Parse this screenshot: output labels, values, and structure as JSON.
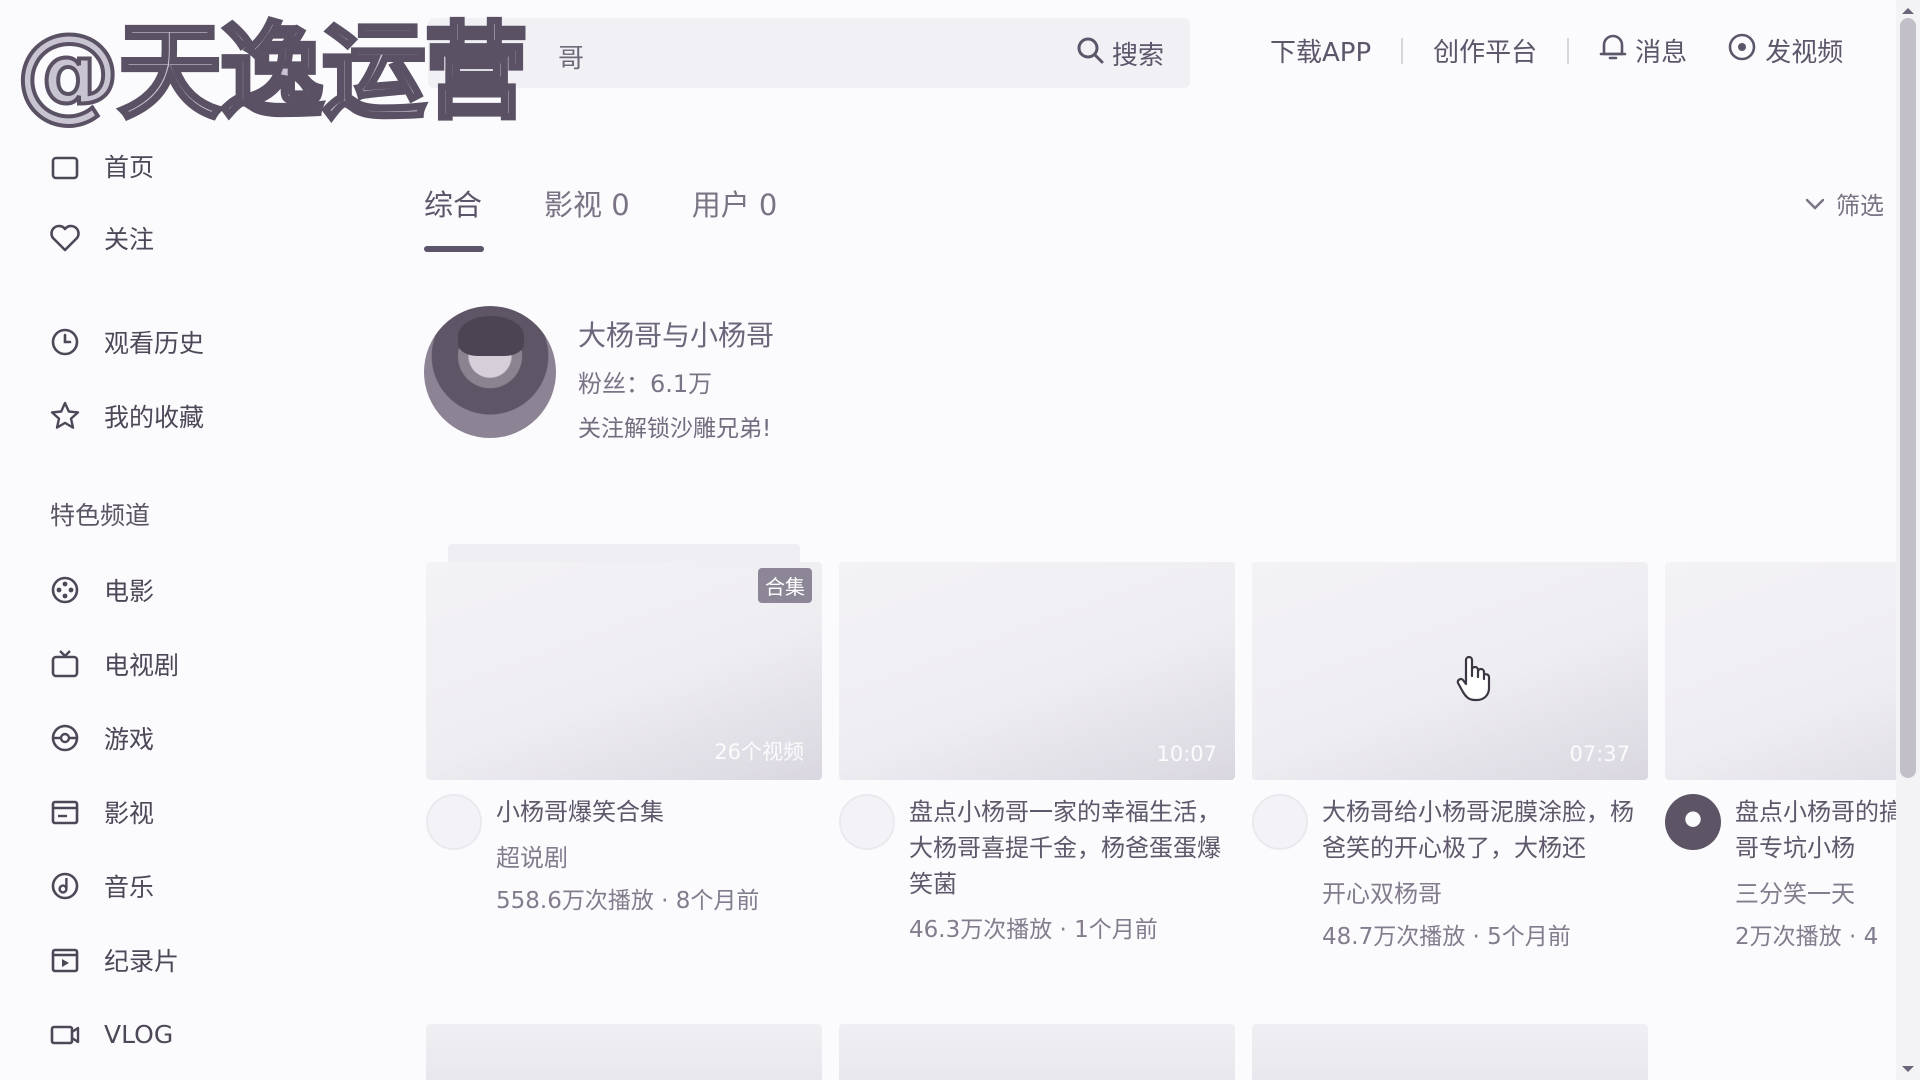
{
  "watermark": "@天逸运营",
  "header": {
    "search_query": "哥",
    "search_button": "搜索",
    "download_app": "下载APP",
    "creator_platform": "创作平台",
    "messages": "消息",
    "upload_video": "发视频"
  },
  "sidebar": {
    "home": "首页",
    "follow": "关注",
    "history": "观看历史",
    "favorites": "我的收藏",
    "section_title": "特色频道",
    "channels": [
      "电影",
      "电视剧",
      "游戏",
      "影视",
      "音乐",
      "纪录片",
      "VLOG"
    ]
  },
  "tabs": [
    "综合",
    "影视 0",
    "用户 0"
  ],
  "filter_label": "筛选",
  "user": {
    "name": "大杨哥与小杨哥",
    "fans": "粉丝：6.1万",
    "desc": "关注解锁沙雕兄弟!"
  },
  "videos": [
    {
      "badge": "合集",
      "overlay": "26个视频",
      "title": "小杨哥爆笑合集",
      "author": "超说剧",
      "stats": "558.6万次播放 · 8个月前"
    },
    {
      "overlay": "10:07",
      "title": "盘点小杨哥一家的幸福生活，大杨哥喜提千金，杨爸蛋蛋爆笑菌",
      "author": "",
      "stats": "46.3万次播放 · 1个月前"
    },
    {
      "overlay": "07:37",
      "title": "大杨哥给小杨哥泥膜涂脸，杨爸笑的开心极了，大杨还",
      "author": "开心双杨哥",
      "stats": "48.7万次播放 · 5个月前"
    },
    {
      "overlay": "",
      "title": "盘点小杨哥的搞笑日常，大杨哥专坑小杨",
      "author": "三分笑一天",
      "stats": "2万次播放 · 4"
    }
  ],
  "colors": {
    "accent": "#5c5468",
    "background": "#fbfbfd"
  }
}
